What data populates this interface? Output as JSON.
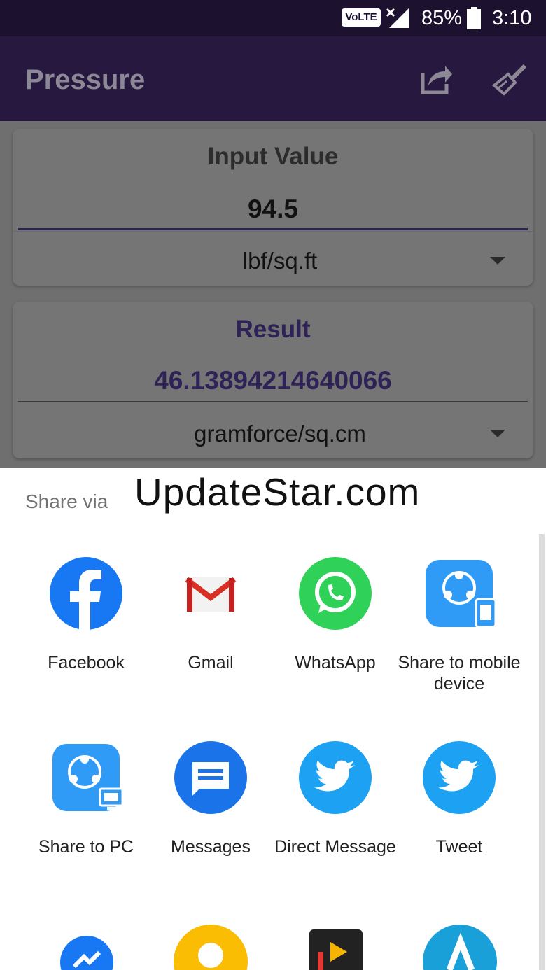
{
  "status_bar": {
    "network_badge": "VoLTE",
    "battery_percent": "85%",
    "time": "3:10"
  },
  "app_bar": {
    "title": "Pressure",
    "share_icon": "share-icon",
    "clear_icon": "broom-icon"
  },
  "input_card": {
    "title": "Input Value",
    "value": "94.5",
    "unit": "lbf/sq.ft"
  },
  "result_card": {
    "title": "Result",
    "value": "46.13894214640066",
    "unit": "gramforce/sq.cm"
  },
  "share_sheet": {
    "title": "Share via",
    "watermark": "UpdateStar.com",
    "apps": [
      {
        "label": "Facebook",
        "icon": "facebook-icon"
      },
      {
        "label": "Gmail",
        "icon": "gmail-icon"
      },
      {
        "label": "WhatsApp",
        "icon": "whatsapp-icon"
      },
      {
        "label": "Share to mobile device",
        "icon": "shareit-mobile-icon"
      },
      {
        "label": "Share to PC",
        "icon": "shareit-pc-icon"
      },
      {
        "label": "Messages",
        "icon": "messages-icon"
      },
      {
        "label": "Direct Message",
        "icon": "twitter-icon"
      },
      {
        "label": "Tweet",
        "icon": "twitter-icon"
      }
    ]
  },
  "colors": {
    "app_bar": "#26183f",
    "accent": "#3e2a77",
    "status_bar": "#1c1230"
  }
}
